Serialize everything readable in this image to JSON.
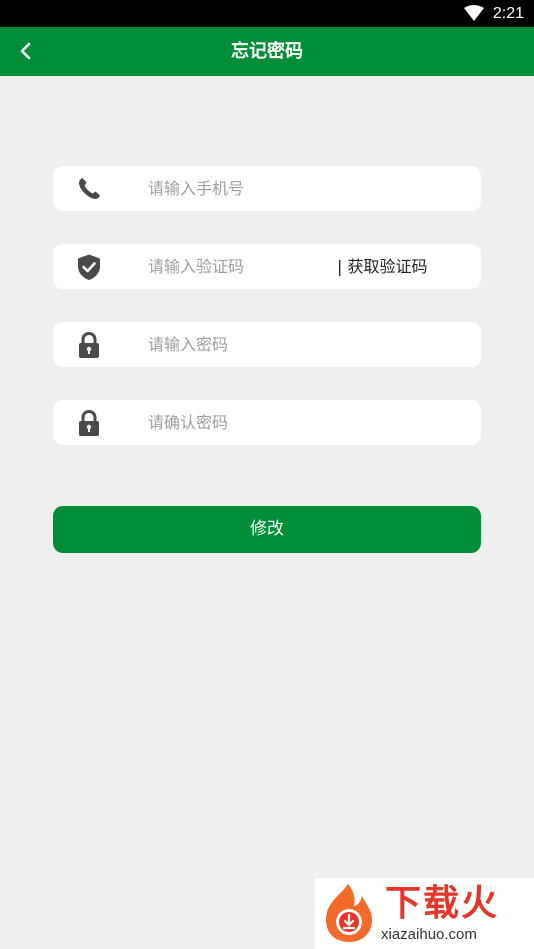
{
  "status_bar": {
    "time": "2:21",
    "icons": [
      "wifi-icon"
    ]
  },
  "app_bar": {
    "title": "忘记密码",
    "back_icon": "chevron-left-icon"
  },
  "form": {
    "phone": {
      "placeholder": "请输入手机号",
      "value": "",
      "icon": "phone-icon"
    },
    "code": {
      "placeholder": "请输入验证码",
      "value": "",
      "icon": "shield-check-icon",
      "action_label": "| 获取验证码"
    },
    "password": {
      "placeholder": "请输入密码",
      "value": "",
      "icon": "lock-icon"
    },
    "confirm_password": {
      "placeholder": "请确认密码",
      "value": "",
      "icon": "lock-icon"
    },
    "submit_label": "修改"
  },
  "watermark": {
    "brand": "下载火",
    "domain": "xiazaihuo.com"
  },
  "colors": {
    "primary": "#028e36",
    "background": "#efefef",
    "icon": "#4a4a4a",
    "placeholder": "#9e9e9e"
  }
}
